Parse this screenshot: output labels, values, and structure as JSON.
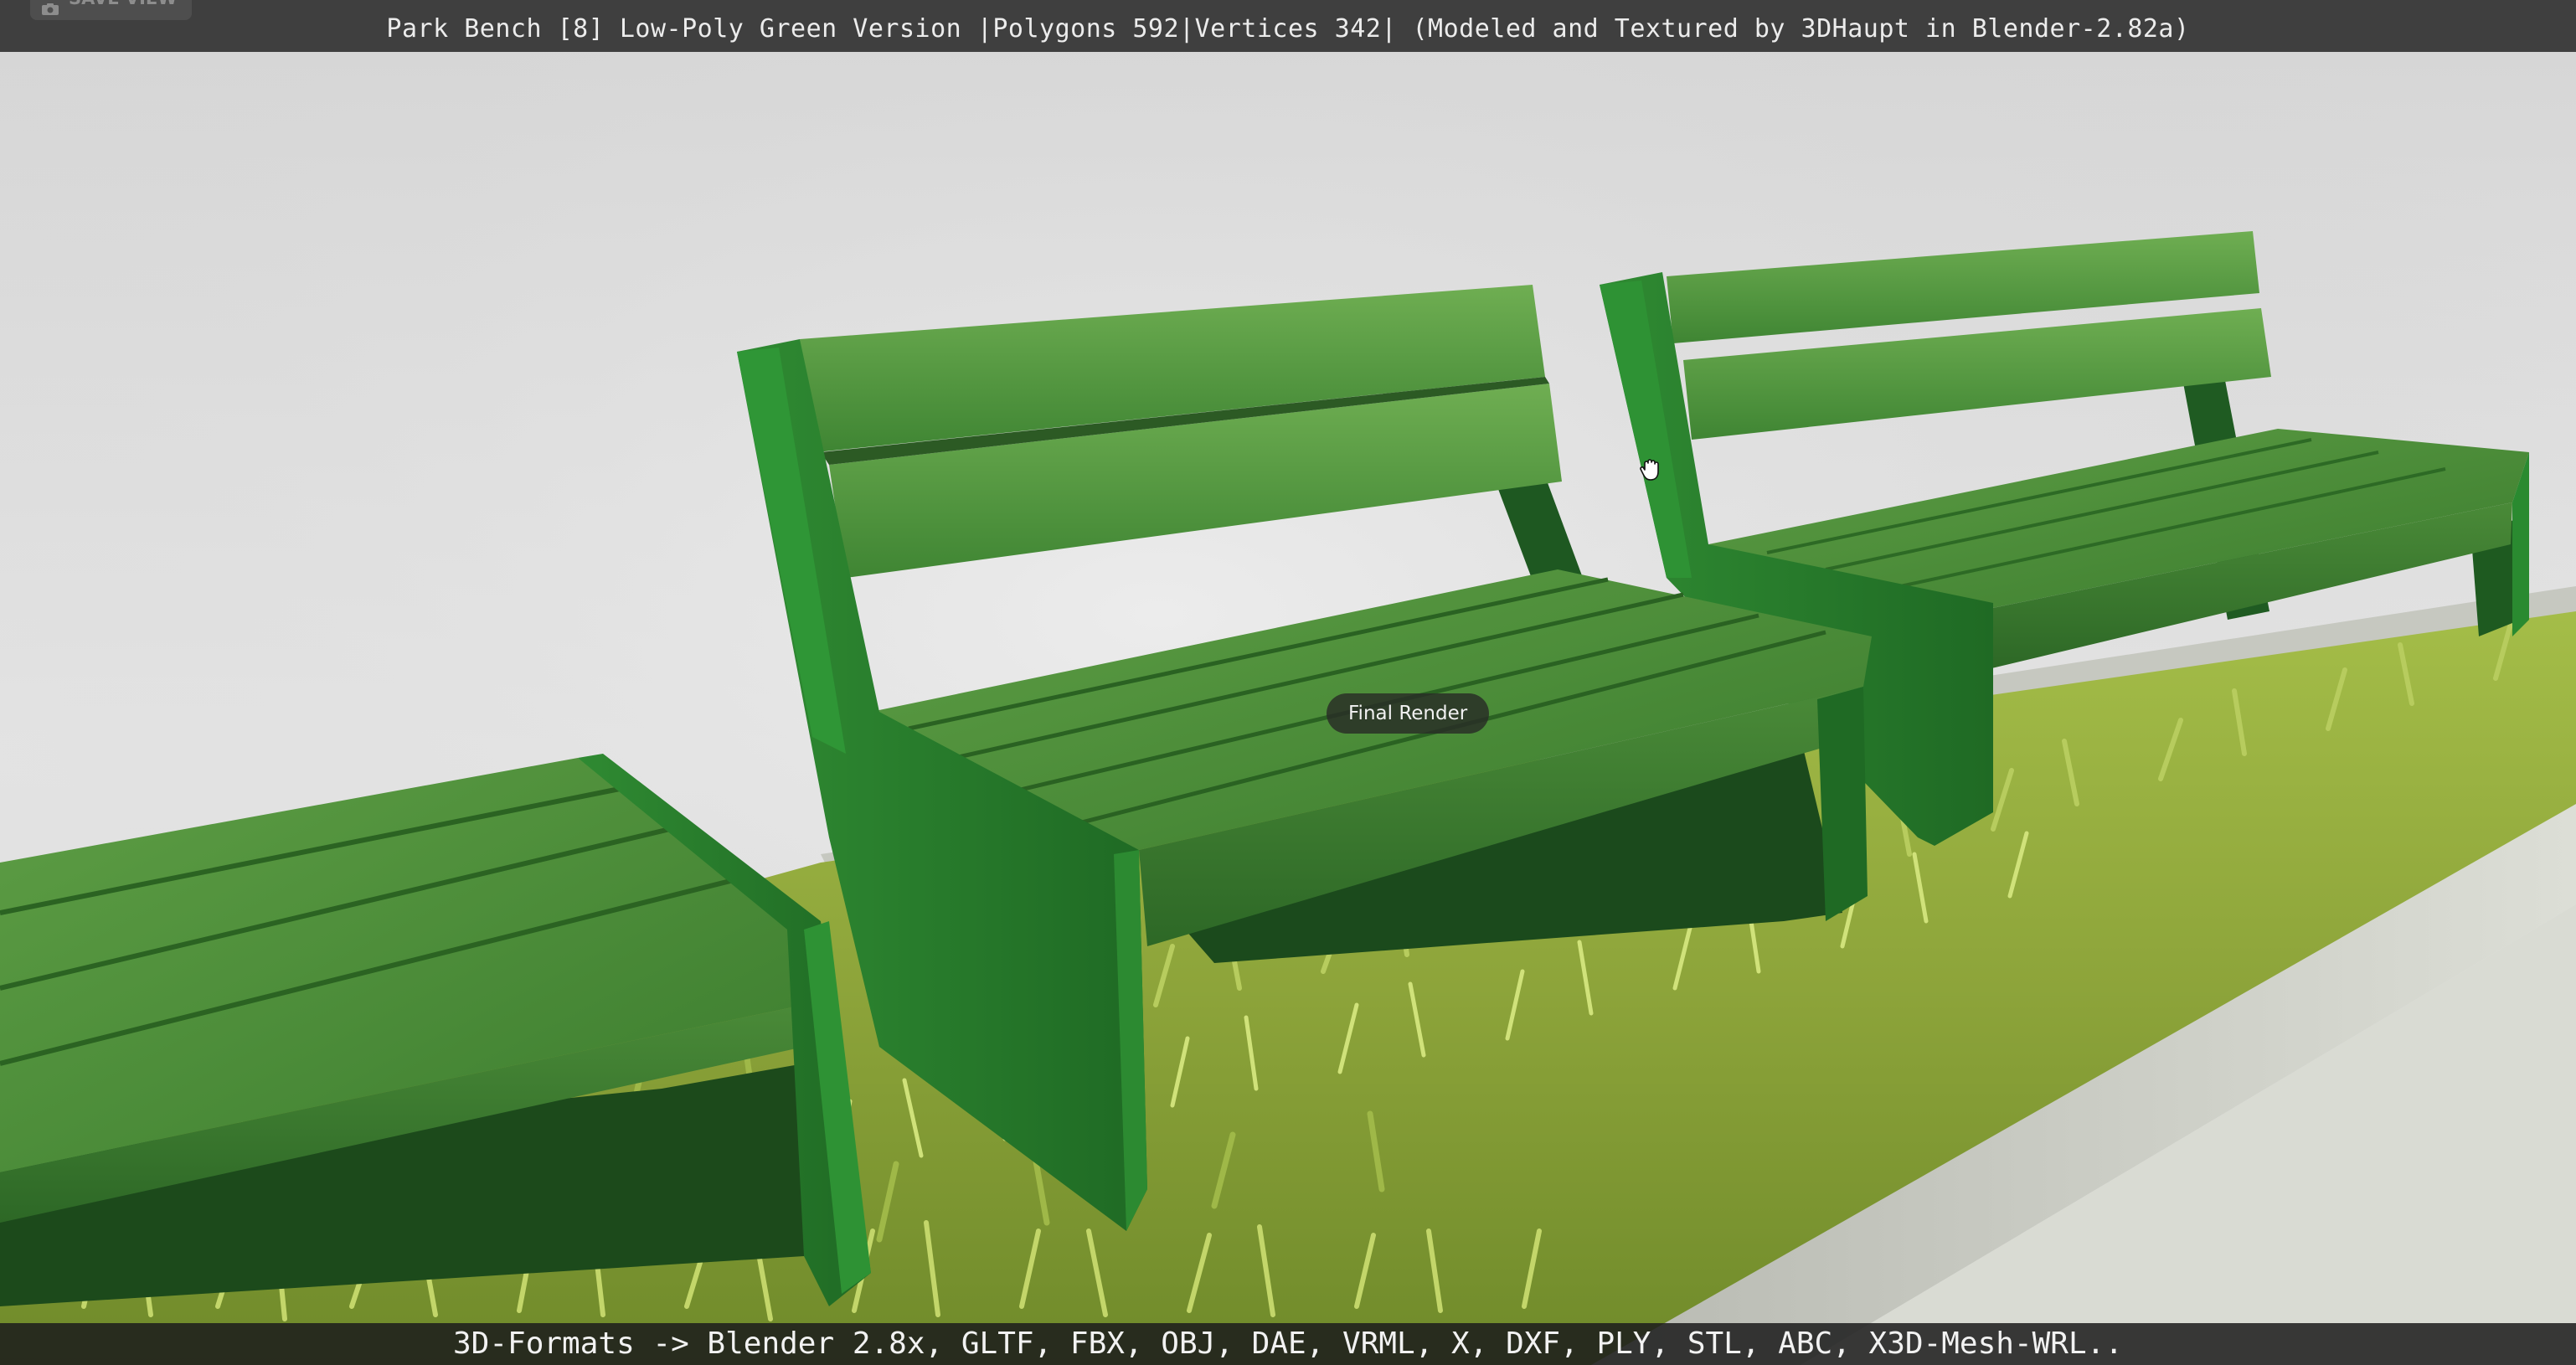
{
  "viewer": {
    "title": "Park Bench [8] Low-Poly Green Version |Polygons 592|Vertices 342| (Modeled and Textured by 3DHaupt in Blender-2.82a)",
    "save_view_label": "SAVE VIEW",
    "save_view_icon": "camera-icon",
    "render_badge": "Final Render",
    "formats_caption": "3D-Formats -> Blender 2.8x, GLTF, FBX, OBJ, DAE, VRML, X, DXF, PLY, STL, ABC, X3D-Mesh-WRL..",
    "cursor_icon": "hand-grab-icon"
  },
  "colors": {
    "backdrop": "#dcdcdc",
    "bench_green": "#3f8a35",
    "bench_green_light": "#67a84c",
    "bench_green_dark": "#1f5b22",
    "grass": "#8ea83a",
    "curb": "#c8cac2"
  }
}
